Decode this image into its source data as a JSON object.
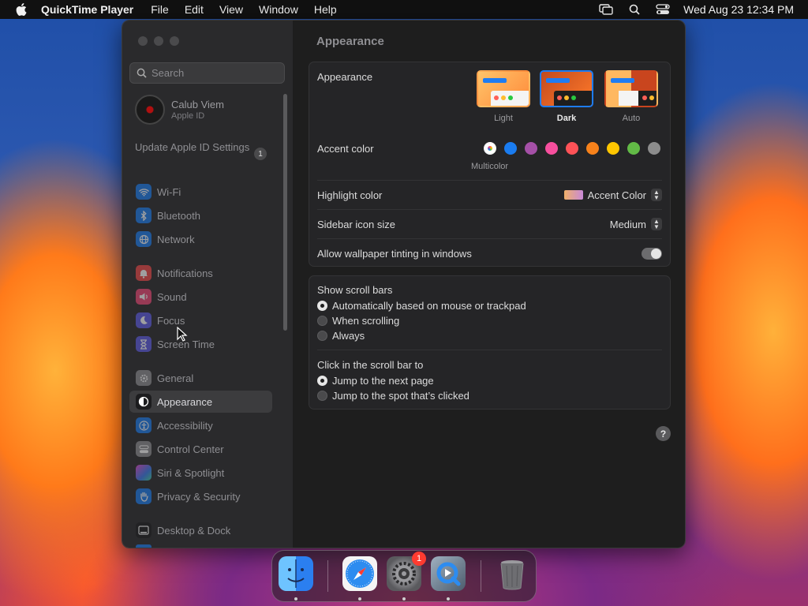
{
  "menubar": {
    "app_name": "QuickTime Player",
    "menus": [
      "File",
      "Edit",
      "View",
      "Window",
      "Help"
    ],
    "clock": "Wed Aug 23  12:34 PM",
    "icons": [
      "screen-mirroring-icon",
      "spotlight-icon",
      "control-center-icon"
    ]
  },
  "sidebar": {
    "search_placeholder": "Search",
    "profile": {
      "name": "Calub Viem",
      "subtitle": "Apple ID"
    },
    "update": {
      "label": "Update Apple ID Settings",
      "badge": "1"
    },
    "items": [
      {
        "label": "Wi-Fi",
        "icon": "wifi-icon",
        "color": "#1a7cf0"
      },
      {
        "label": "Bluetooth",
        "icon": "bluetooth-icon",
        "color": "#1a7cf0"
      },
      {
        "label": "Network",
        "icon": "globe-icon",
        "color": "#1a7cf0"
      },
      {
        "label": "Notifications",
        "icon": "bell-icon",
        "color": "#f04848"
      },
      {
        "label": "Sound",
        "icon": "speaker-icon",
        "color": "#f04878"
      },
      {
        "label": "Focus",
        "icon": "moon-icon",
        "color": "#5e5ce6"
      },
      {
        "label": "Screen Time",
        "icon": "hourglass-icon",
        "color": "#5e5ce6"
      },
      {
        "label": "General",
        "icon": "gear-icon",
        "color": "#8e8e93"
      },
      {
        "label": "Appearance",
        "icon": "appearance-icon",
        "color": "#1c1c1e"
      },
      {
        "label": "Accessibility",
        "icon": "accessibility-icon",
        "color": "#1a7cf0"
      },
      {
        "label": "Control Center",
        "icon": "control-center-icon",
        "color": "#8e8e93"
      },
      {
        "label": "Siri & Spotlight",
        "icon": "siri-icon",
        "color": "#b14bd8"
      },
      {
        "label": "Privacy & Security",
        "icon": "hand-icon",
        "color": "#1a7cf0"
      },
      {
        "label": "Desktop & Dock",
        "icon": "dock-icon",
        "color": "#1c1c1e"
      }
    ],
    "active": "Appearance"
  },
  "content": {
    "title": "Appearance",
    "appearance": {
      "label": "Appearance",
      "options": [
        "Light",
        "Dark",
        "Auto"
      ],
      "selected": "Dark"
    },
    "accent": {
      "label": "Accent color",
      "colors": [
        "#8e8e93",
        "#1a7cf0",
        "#a550a7",
        "#f74f9e",
        "#ff5257",
        "#f7821b",
        "#ffc600",
        "#62ba46",
        "#8c8c8c"
      ],
      "selected_name": "Multicolor"
    },
    "highlight": {
      "label": "Highlight color",
      "value": "Accent Color"
    },
    "sidebar_icon_size": {
      "label": "Sidebar icon size",
      "value": "Medium"
    },
    "wallpaper_tinting": {
      "label": "Allow wallpaper tinting in windows",
      "on": true
    },
    "scroll_bars": {
      "label": "Show scroll bars",
      "options": [
        "Automatically based on mouse or trackpad",
        "When scrolling",
        "Always"
      ],
      "selected": 0
    },
    "click_scroll": {
      "label": "Click in the scroll bar to",
      "options": [
        "Jump to the next page",
        "Jump to the spot that’s clicked"
      ],
      "selected": 0
    },
    "help": "?"
  },
  "dock": {
    "apps": [
      "Finder",
      "Safari",
      "System Settings",
      "QuickTime Player",
      "Trash"
    ],
    "settings_badge": "1"
  }
}
